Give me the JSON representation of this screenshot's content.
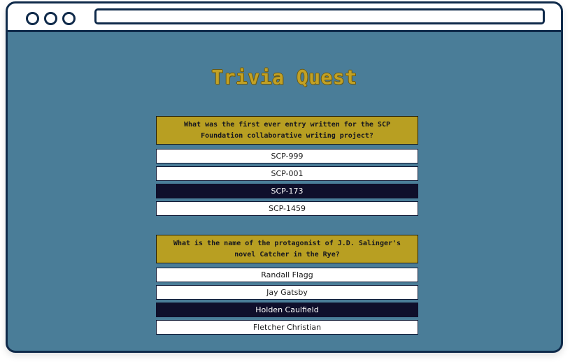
{
  "app": {
    "title": "Trivia Quest"
  },
  "questions": [
    {
      "text": "What was the first ever entry written for the SCP Foundation collaborative writing project?",
      "answers": [
        "SCP-999",
        "SCP-001",
        "SCP-173",
        "SCP-1459"
      ],
      "selected_index": 2
    },
    {
      "text": "What is the name of the protagonist of J.D. Salinger's novel Catcher in the Rye?",
      "answers": [
        "Randall Flagg",
        "Jay Gatsby",
        "Holden Caulfield",
        "Fletcher Christian"
      ],
      "selected_index": 2
    }
  ],
  "colors": {
    "page_background": "#4a7d98",
    "frame_border": "#0f2a4a",
    "title_gold": "#c2a124",
    "question_card": "#b89f22",
    "answer_default": "#ffffff",
    "answer_selected": "#0f0f2b"
  }
}
